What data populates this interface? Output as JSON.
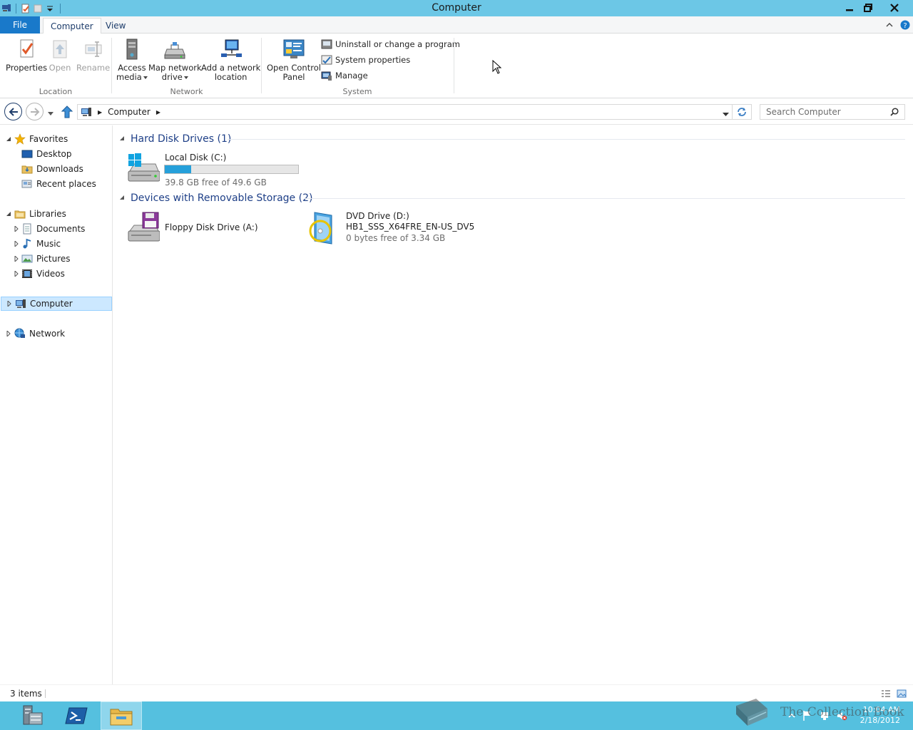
{
  "window": {
    "title": "Computer"
  },
  "ribbon": {
    "tabs": {
      "file": "File",
      "computer": "Computer",
      "view": "View"
    },
    "groups": {
      "location": {
        "label": "Location",
        "properties": "Properties",
        "open": "Open",
        "rename": "Rename"
      },
      "network": {
        "label": "Network",
        "access_media": [
          "Access",
          "media"
        ],
        "map_network_drive": [
          "Map network",
          "drive"
        ],
        "add_network_location": [
          "Add a network",
          "location"
        ]
      },
      "system": {
        "label": "System",
        "open_control_panel": [
          "Open Control",
          "Panel"
        ],
        "uninstall": "Uninstall or change a program",
        "system_properties": "System properties",
        "manage": "Manage"
      }
    }
  },
  "address": {
    "crumb": "Computer",
    "search_placeholder": "Search Computer"
  },
  "nav": {
    "favorites": "Favorites",
    "desktop": "Desktop",
    "downloads": "Downloads",
    "recent": "Recent places",
    "libraries": "Libraries",
    "documents": "Documents",
    "music": "Music",
    "pictures": "Pictures",
    "videos": "Videos",
    "computer": "Computer",
    "network": "Network"
  },
  "content": {
    "groups": [
      {
        "header": "Hard Disk Drives (1)",
        "items": [
          {
            "name": "Local Disk (C:)",
            "free": "39.8 GB free of 49.6 GB",
            "used_fraction": 0.2
          }
        ]
      },
      {
        "header": "Devices with Removable Storage (2)",
        "items": [
          {
            "name": "Floppy Disk Drive (A:)"
          },
          {
            "name": "DVD Drive (D:)",
            "label": "HB1_SSS_X64FRE_EN-US_DV5",
            "free": "0 bytes free of 3.34 GB"
          }
        ]
      }
    ]
  },
  "status": {
    "count": "3 items"
  },
  "taskbar": {
    "time": "10:04 AM",
    "date": "2/18/2012"
  },
  "watermark": "The Collection Book",
  "colors": {
    "titlebar": "#6cc7e6",
    "taskbar": "#55c0df",
    "file_tab": "#1979ca",
    "accent_text": "#1e3f87",
    "progress": "#26a0da"
  }
}
